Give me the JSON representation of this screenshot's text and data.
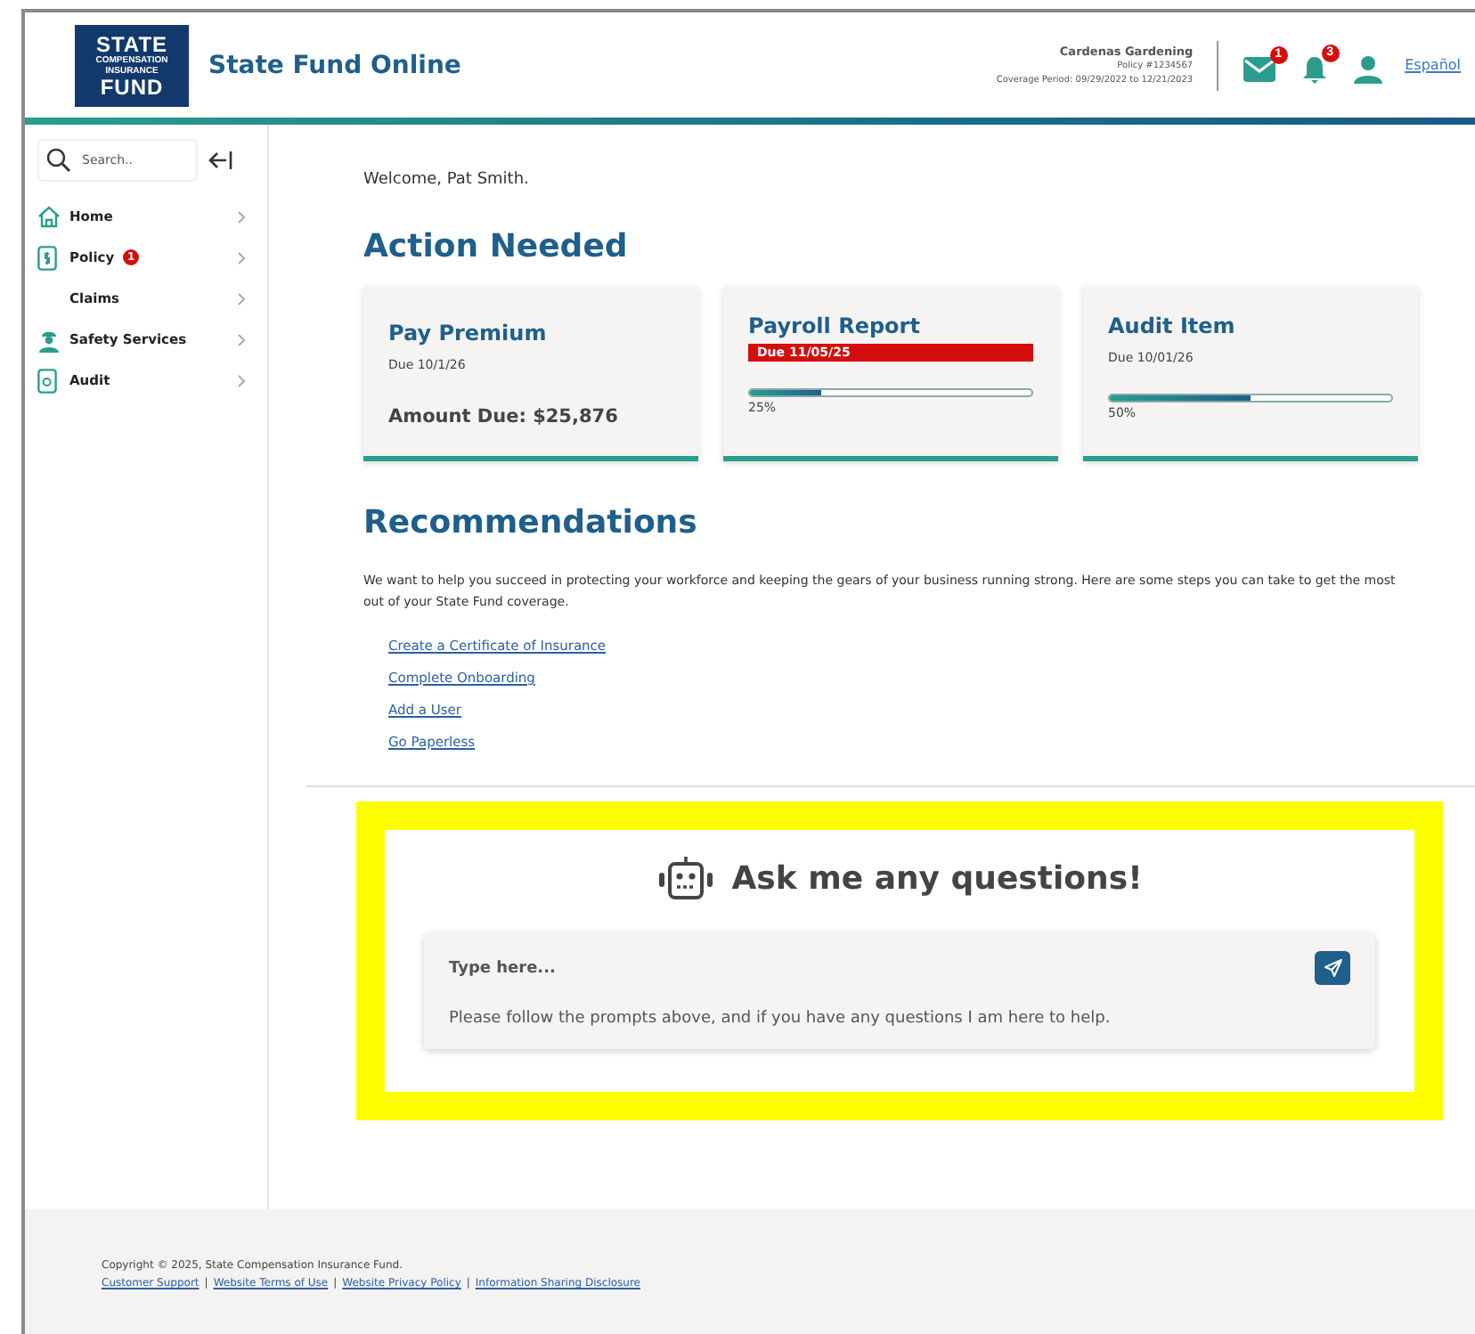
{
  "header": {
    "logo": {
      "top": "STATE",
      "middle": "COMPENSATION INSURANCE",
      "bottom": "FUND"
    },
    "title": "State Fund Online",
    "account": {
      "name": "Cardenas Gardening",
      "policy": "Policy #1234567",
      "coverage": "Coverage Period: 09/29/2022 to 12/21/2023"
    },
    "icons": [
      {
        "kind": "mail",
        "badge": "1"
      },
      {
        "kind": "bell",
        "badge": "3"
      },
      {
        "kind": "user"
      }
    ],
    "language_link": "Español"
  },
  "sidebar": {
    "search": {
      "placeholder": "Search.."
    },
    "items": [
      {
        "label": "Home",
        "kind": "home"
      },
      {
        "label": "Policy",
        "kind": "policy",
        "badge": "1"
      },
      {
        "label": "Claims",
        "kind": "plain"
      },
      {
        "label": "Safety Services",
        "kind": "safety"
      },
      {
        "label": "Audit",
        "kind": "audit"
      }
    ]
  },
  "main": {
    "welcome": "Welcome, Pat Smith.",
    "action_title": "Action Needed",
    "cards": [
      {
        "kind": "amount",
        "title": "Pay Premium",
        "due": "Due 10/1/26",
        "overdue": false,
        "amount": "Amount Due: $25,876"
      },
      {
        "kind": "progress",
        "title": "Payroll Report",
        "due": "Due 11/05/25",
        "overdue": true,
        "level": 0.25,
        "reading": "25%"
      },
      {
        "kind": "progress",
        "title": "Audit Item",
        "due": "Due 10/01/26",
        "overdue": false,
        "level": 0.5,
        "reading": "50%"
      }
    ],
    "recommendations_title": "Recommendations",
    "recommendations_text": "We want to help you succeed in protecting your workforce and keeping the gears of your business running strong. Here are some steps you can take to get the most out of your State Fund coverage.",
    "links": [
      "Create a Certificate of Insurance",
      "Complete Onboarding",
      "Add a User",
      "Go Paperless"
    ],
    "chat": {
      "highlighted": true,
      "title": "Ask me any questions!",
      "placeholder": "Type here...",
      "message": "Please follow the prompts above, and if you have any questions I am here to help."
    }
  },
  "footer": {
    "copyright": "Copyright © 2025, State Compensation Insurance Fund.",
    "separator": "|",
    "links": [
      "Customer Support",
      "Website Terms of Use",
      "Website Privacy Policy",
      "Information Sharing Disclosure"
    ]
  }
}
